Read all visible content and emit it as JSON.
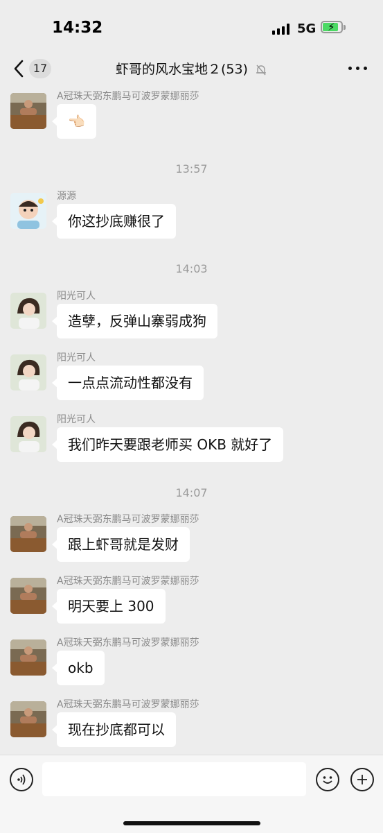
{
  "status_bar": {
    "time": "14:32",
    "network": "5G"
  },
  "nav": {
    "unread_count": "17",
    "title": "虾哥的风水宝地２(53)"
  },
  "messages": [
    {
      "type": "msg",
      "sender": "A冠珠天弼东鹏马可波罗蒙娜丽莎",
      "text": "👈🏻",
      "avatar": "avatar-gym"
    },
    {
      "type": "time",
      "text": "13:57"
    },
    {
      "type": "msg",
      "sender": "源源",
      "text": "你这抄底赚很了",
      "avatar": "avatar-baby"
    },
    {
      "type": "time",
      "text": "14:03"
    },
    {
      "type": "msg",
      "sender": "阳光可人",
      "text": "造孽，反弹山寨弱成狗",
      "avatar": "avatar-woman"
    },
    {
      "type": "msg",
      "sender": "阳光可人",
      "text": "一点点流动性都没有",
      "avatar": "avatar-woman"
    },
    {
      "type": "msg",
      "sender": "阳光可人",
      "text": "我们昨天要跟老师买 OKB 就好了",
      "avatar": "avatar-woman"
    },
    {
      "type": "time",
      "text": "14:07"
    },
    {
      "type": "msg",
      "sender": "A冠珠天弼东鹏马可波罗蒙娜丽莎",
      "text": "跟上虾哥就是发财",
      "avatar": "avatar-gym"
    },
    {
      "type": "msg",
      "sender": "A冠珠天弼东鹏马可波罗蒙娜丽莎",
      "text": "明天要上 300",
      "avatar": "avatar-gym"
    },
    {
      "type": "msg",
      "sender": "A冠珠天弼东鹏马可波罗蒙娜丽莎",
      "text": "okb",
      "avatar": "avatar-gym"
    },
    {
      "type": "msg",
      "sender": "A冠珠天弼东鹏马可波罗蒙娜丽莎",
      "text": "现在抄底都可以",
      "avatar": "avatar-gym"
    }
  ],
  "input": {
    "placeholder": ""
  },
  "colors": {
    "background": "#ededed",
    "bubble": "#ffffff",
    "battery": "#4cd964"
  }
}
